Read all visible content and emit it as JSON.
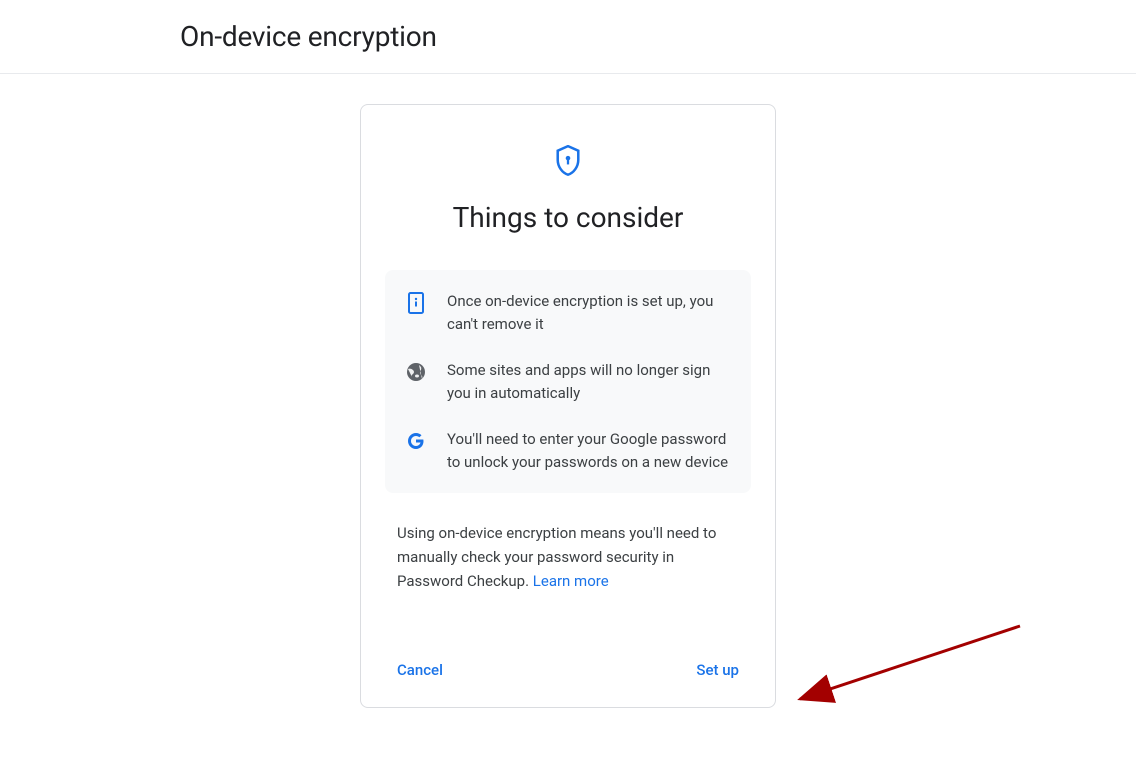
{
  "header": {
    "title": "On-device encryption"
  },
  "card": {
    "title": "Things to consider",
    "items": [
      {
        "icon": "phone-info-icon",
        "text": "Once on-device encryption is set up, you can't remove it"
      },
      {
        "icon": "globe-icon",
        "text": "Some sites and apps will no longer sign you in automatically"
      },
      {
        "icon": "google-g-icon",
        "text": "You'll need to enter your Google password to unlock your passwords on a new device"
      }
    ],
    "footer_text": "Using on-device encryption means you'll need to manually check your password security in Password Checkup. ",
    "learn_more": "Learn more",
    "cancel": "Cancel",
    "setup": "Set up"
  }
}
